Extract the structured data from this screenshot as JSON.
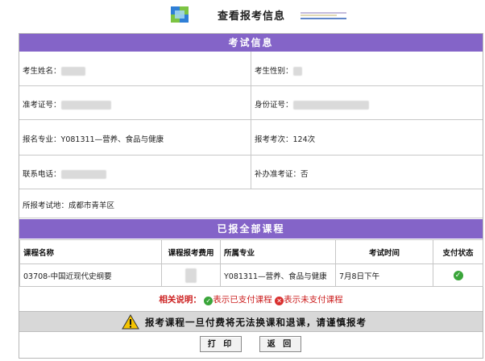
{
  "header": {
    "title": "查看报考信息"
  },
  "exam_info": {
    "section_title": "考试信息",
    "name_label": "考生姓名：",
    "gender_label": "考生性别：",
    "ticket_label": "准考证号：",
    "id_label": "身份证号：",
    "major_label": "报名专业：",
    "major_value": "Y081311—营养、食品与健康",
    "count_label": "报考考次：",
    "count_value": "124次",
    "phone_label": "联系电话：",
    "reissue_label": "补办准考证：",
    "reissue_value": "否",
    "location_label": "所报考试地：",
    "location_value": "成都市青羊区"
  },
  "courses": {
    "section_title": "已报全部课程",
    "headers": [
      "课程名称",
      "课程报考费用",
      "所属专业",
      "考试时间",
      "支付状态"
    ],
    "rows": [
      {
        "name": "03708-中国近现代史纲要",
        "major": "Y081311—营养、食品与健康",
        "time": "7月8日下午"
      }
    ]
  },
  "legend": {
    "key": "相关说明：",
    "paid_text": "表示已支付课程",
    "unpaid_text": "表示未支付课程"
  },
  "warning": {
    "text": "报考课程一旦付费将无法换课和退课，请谨慎报考"
  },
  "buttons": {
    "print": "打 印",
    "back": "返 回"
  }
}
